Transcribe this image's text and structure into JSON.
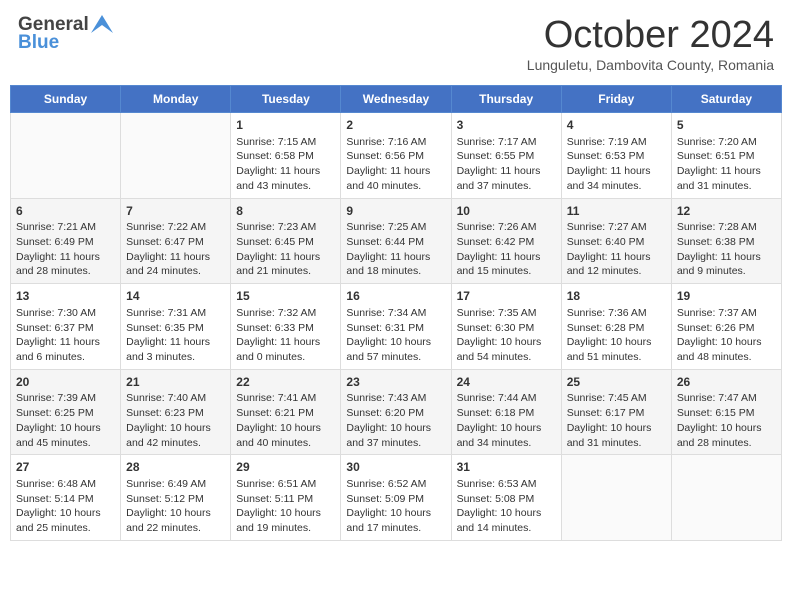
{
  "header": {
    "logo_general": "General",
    "logo_blue": "Blue",
    "month_title": "October 2024",
    "location": "Lunguletu, Dambovita County, Romania"
  },
  "days_of_week": [
    "Sunday",
    "Monday",
    "Tuesday",
    "Wednesday",
    "Thursday",
    "Friday",
    "Saturday"
  ],
  "weeks": [
    [
      {
        "day": null,
        "data": null
      },
      {
        "day": null,
        "data": null
      },
      {
        "day": "1",
        "sunrise": "Sunrise: 7:15 AM",
        "sunset": "Sunset: 6:58 PM",
        "daylight": "Daylight: 11 hours and 43 minutes."
      },
      {
        "day": "2",
        "sunrise": "Sunrise: 7:16 AM",
        "sunset": "Sunset: 6:56 PM",
        "daylight": "Daylight: 11 hours and 40 minutes."
      },
      {
        "day": "3",
        "sunrise": "Sunrise: 7:17 AM",
        "sunset": "Sunset: 6:55 PM",
        "daylight": "Daylight: 11 hours and 37 minutes."
      },
      {
        "day": "4",
        "sunrise": "Sunrise: 7:19 AM",
        "sunset": "Sunset: 6:53 PM",
        "daylight": "Daylight: 11 hours and 34 minutes."
      },
      {
        "day": "5",
        "sunrise": "Sunrise: 7:20 AM",
        "sunset": "Sunset: 6:51 PM",
        "daylight": "Daylight: 11 hours and 31 minutes."
      }
    ],
    [
      {
        "day": "6",
        "sunrise": "Sunrise: 7:21 AM",
        "sunset": "Sunset: 6:49 PM",
        "daylight": "Daylight: 11 hours and 28 minutes."
      },
      {
        "day": "7",
        "sunrise": "Sunrise: 7:22 AM",
        "sunset": "Sunset: 6:47 PM",
        "daylight": "Daylight: 11 hours and 24 minutes."
      },
      {
        "day": "8",
        "sunrise": "Sunrise: 7:23 AM",
        "sunset": "Sunset: 6:45 PM",
        "daylight": "Daylight: 11 hours and 21 minutes."
      },
      {
        "day": "9",
        "sunrise": "Sunrise: 7:25 AM",
        "sunset": "Sunset: 6:44 PM",
        "daylight": "Daylight: 11 hours and 18 minutes."
      },
      {
        "day": "10",
        "sunrise": "Sunrise: 7:26 AM",
        "sunset": "Sunset: 6:42 PM",
        "daylight": "Daylight: 11 hours and 15 minutes."
      },
      {
        "day": "11",
        "sunrise": "Sunrise: 7:27 AM",
        "sunset": "Sunset: 6:40 PM",
        "daylight": "Daylight: 11 hours and 12 minutes."
      },
      {
        "day": "12",
        "sunrise": "Sunrise: 7:28 AM",
        "sunset": "Sunset: 6:38 PM",
        "daylight": "Daylight: 11 hours and 9 minutes."
      }
    ],
    [
      {
        "day": "13",
        "sunrise": "Sunrise: 7:30 AM",
        "sunset": "Sunset: 6:37 PM",
        "daylight": "Daylight: 11 hours and 6 minutes."
      },
      {
        "day": "14",
        "sunrise": "Sunrise: 7:31 AM",
        "sunset": "Sunset: 6:35 PM",
        "daylight": "Daylight: 11 hours and 3 minutes."
      },
      {
        "day": "15",
        "sunrise": "Sunrise: 7:32 AM",
        "sunset": "Sunset: 6:33 PM",
        "daylight": "Daylight: 11 hours and 0 minutes."
      },
      {
        "day": "16",
        "sunrise": "Sunrise: 7:34 AM",
        "sunset": "Sunset: 6:31 PM",
        "daylight": "Daylight: 10 hours and 57 minutes."
      },
      {
        "day": "17",
        "sunrise": "Sunrise: 7:35 AM",
        "sunset": "Sunset: 6:30 PM",
        "daylight": "Daylight: 10 hours and 54 minutes."
      },
      {
        "day": "18",
        "sunrise": "Sunrise: 7:36 AM",
        "sunset": "Sunset: 6:28 PM",
        "daylight": "Daylight: 10 hours and 51 minutes."
      },
      {
        "day": "19",
        "sunrise": "Sunrise: 7:37 AM",
        "sunset": "Sunset: 6:26 PM",
        "daylight": "Daylight: 10 hours and 48 minutes."
      }
    ],
    [
      {
        "day": "20",
        "sunrise": "Sunrise: 7:39 AM",
        "sunset": "Sunset: 6:25 PM",
        "daylight": "Daylight: 10 hours and 45 minutes."
      },
      {
        "day": "21",
        "sunrise": "Sunrise: 7:40 AM",
        "sunset": "Sunset: 6:23 PM",
        "daylight": "Daylight: 10 hours and 42 minutes."
      },
      {
        "day": "22",
        "sunrise": "Sunrise: 7:41 AM",
        "sunset": "Sunset: 6:21 PM",
        "daylight": "Daylight: 10 hours and 40 minutes."
      },
      {
        "day": "23",
        "sunrise": "Sunrise: 7:43 AM",
        "sunset": "Sunset: 6:20 PM",
        "daylight": "Daylight: 10 hours and 37 minutes."
      },
      {
        "day": "24",
        "sunrise": "Sunrise: 7:44 AM",
        "sunset": "Sunset: 6:18 PM",
        "daylight": "Daylight: 10 hours and 34 minutes."
      },
      {
        "day": "25",
        "sunrise": "Sunrise: 7:45 AM",
        "sunset": "Sunset: 6:17 PM",
        "daylight": "Daylight: 10 hours and 31 minutes."
      },
      {
        "day": "26",
        "sunrise": "Sunrise: 7:47 AM",
        "sunset": "Sunset: 6:15 PM",
        "daylight": "Daylight: 10 hours and 28 minutes."
      }
    ],
    [
      {
        "day": "27",
        "sunrise": "Sunrise: 6:48 AM",
        "sunset": "Sunset: 5:14 PM",
        "daylight": "Daylight: 10 hours and 25 minutes."
      },
      {
        "day": "28",
        "sunrise": "Sunrise: 6:49 AM",
        "sunset": "Sunset: 5:12 PM",
        "daylight": "Daylight: 10 hours and 22 minutes."
      },
      {
        "day": "29",
        "sunrise": "Sunrise: 6:51 AM",
        "sunset": "Sunset: 5:11 PM",
        "daylight": "Daylight: 10 hours and 19 minutes."
      },
      {
        "day": "30",
        "sunrise": "Sunrise: 6:52 AM",
        "sunset": "Sunset: 5:09 PM",
        "daylight": "Daylight: 10 hours and 17 minutes."
      },
      {
        "day": "31",
        "sunrise": "Sunrise: 6:53 AM",
        "sunset": "Sunset: 5:08 PM",
        "daylight": "Daylight: 10 hours and 14 minutes."
      },
      {
        "day": null,
        "data": null
      },
      {
        "day": null,
        "data": null
      }
    ]
  ]
}
